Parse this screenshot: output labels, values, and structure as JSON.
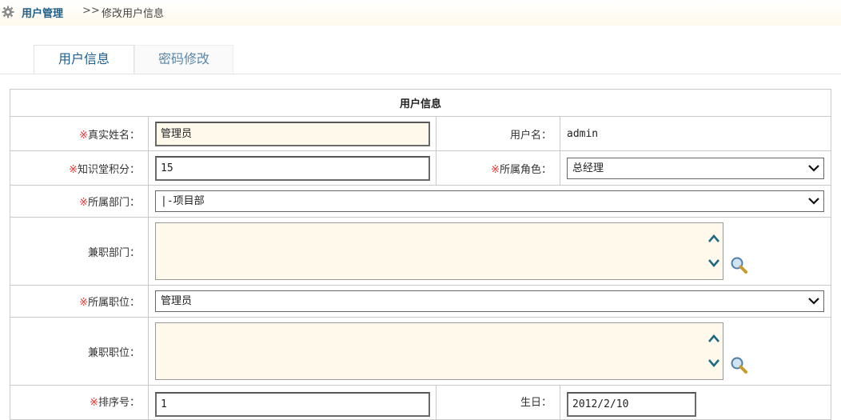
{
  "breadcrumb": {
    "section": "用户管理",
    "separator": ">>",
    "current": "修改用户信息"
  },
  "tabs": [
    {
      "label": "用户信息",
      "active": true
    },
    {
      "label": "密码修改",
      "active": false
    }
  ],
  "form": {
    "title": "用户信息",
    "required_mark": "※",
    "real_name": {
      "label": "真实姓名：",
      "value": "管理员"
    },
    "username": {
      "label": "用户名：",
      "value": "admin"
    },
    "points": {
      "label": "知识堂积分：",
      "value": "15"
    },
    "role": {
      "label": "所属角色：",
      "value": "总经理"
    },
    "department": {
      "label": "所属部门：",
      "value": "|-项目部"
    },
    "part_dept": {
      "label": "兼职部门："
    },
    "position": {
      "label": "所属职位：",
      "value": "管理员"
    },
    "part_position": {
      "label": "兼职职位："
    },
    "order_no": {
      "label": "排序号：",
      "value": "1"
    },
    "birthday": {
      "label": "生日：",
      "value": "2012/2/10"
    }
  },
  "colors": {
    "accent": "#1f5e87",
    "required": "#ee3333",
    "field_bg": "#fef9ea",
    "border": "#c9c9c9"
  },
  "icons": [
    "gear-icon",
    "chevron-down-icon",
    "chevron-up-icon",
    "magnifier-icon"
  ]
}
